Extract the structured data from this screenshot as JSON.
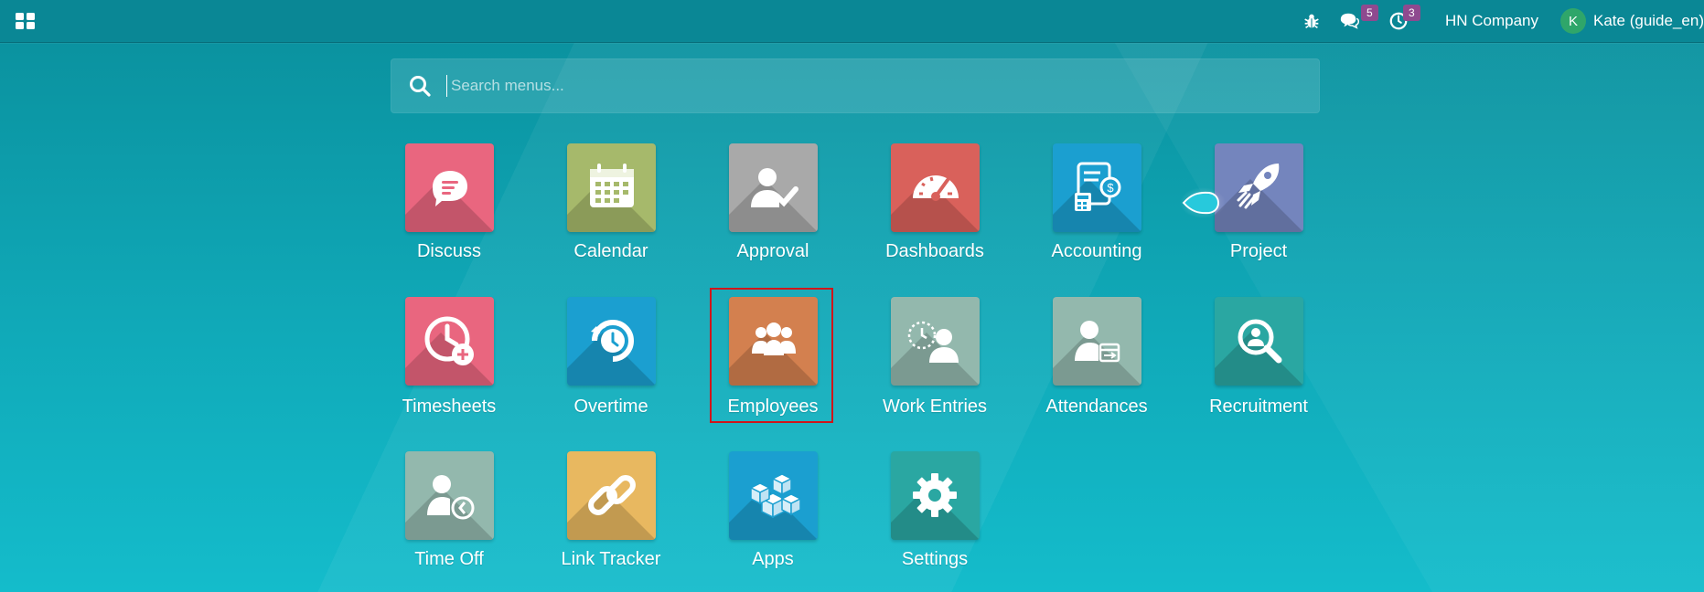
{
  "topbar": {
    "apps_icon": "grid-icon",
    "debug_icon": "bug-icon",
    "messages_icon": "chat-icon",
    "messages_count": "5",
    "activities_icon": "clock-icon",
    "activities_count": "3",
    "company": "HN Company",
    "user_initial": "K",
    "user_name": "Kate (guide_en)"
  },
  "search": {
    "icon": "search-icon",
    "placeholder": "Search menus..."
  },
  "apps": [
    {
      "label": "Discuss",
      "color": "#e9667f",
      "icon": "chat-bubble-icon"
    },
    {
      "label": "Calendar",
      "color": "#a6b96b",
      "icon": "calendar-icon"
    },
    {
      "label": "Approval",
      "color": "#a9a9a9",
      "icon": "user-check-icon"
    },
    {
      "label": "Dashboards",
      "color": "#d9615b",
      "icon": "speedometer-icon"
    },
    {
      "label": "Accounting",
      "color": "#1b9fd0",
      "icon": "invoice-calculator-icon"
    },
    {
      "label": "Project",
      "color": "#7485bd",
      "icon": "rocket-icon"
    },
    {
      "label": "Timesheets",
      "color": "#e9667f",
      "icon": "clock-plus-icon"
    },
    {
      "label": "Overtime",
      "color": "#1b9fd0",
      "icon": "clock-refresh-icon"
    },
    {
      "label": "Employees",
      "color": "#d3804f",
      "icon": "users-icon"
    },
    {
      "label": "Work Entries",
      "color": "#93b8ad",
      "icon": "user-clock-icon"
    },
    {
      "label": "Attendances",
      "color": "#93b8ad",
      "icon": "user-calendar-icon"
    },
    {
      "label": "Recruitment",
      "color": "#2aa7a2",
      "icon": "magnify-user-icon"
    },
    {
      "label": "Time Off",
      "color": "#93b8ad",
      "icon": "user-time-icon"
    },
    {
      "label": "Link Tracker",
      "color": "#e8b860",
      "icon": "link-icon"
    },
    {
      "label": "Apps",
      "color": "#1b9fd0",
      "icon": "cubes-icon"
    },
    {
      "label": "Settings",
      "color": "#2aa7a2",
      "icon": "gear-icon"
    }
  ]
}
